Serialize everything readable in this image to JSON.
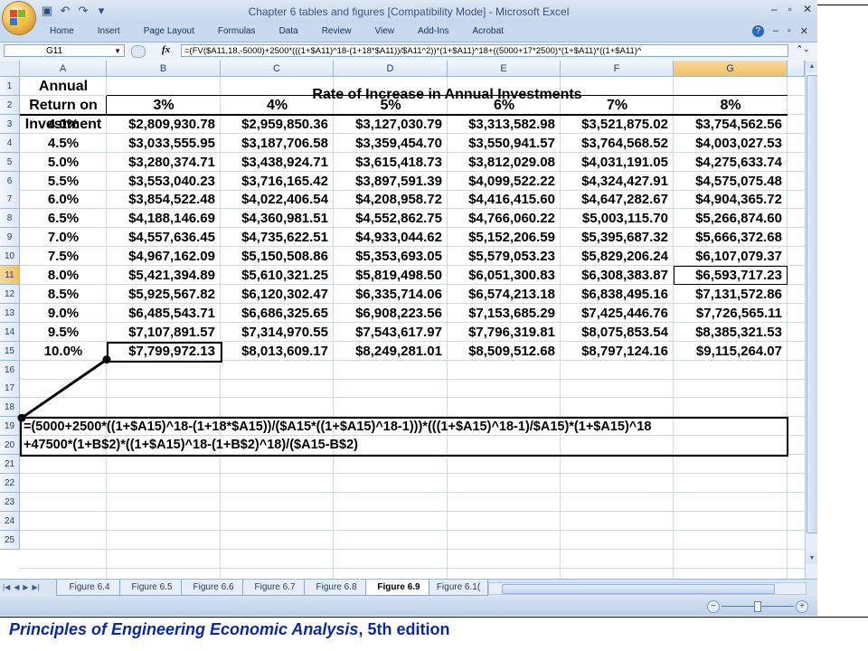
{
  "window": {
    "title": "Chapter 6 tables and figures  [Compatibility Mode] - Microsoft Excel",
    "controls": [
      "–",
      "▫",
      "✕"
    ]
  },
  "quick_access": [
    "save-icon",
    "undo-icon",
    "redo-icon",
    "customize-icon"
  ],
  "menu": {
    "tabs": [
      "Home",
      "Insert",
      "Page Layout",
      "Formulas",
      "Data",
      "Review",
      "View",
      "Add-Ins",
      "Acrobat"
    ]
  },
  "formula_bar": {
    "name_box": "G11",
    "fx": "fx",
    "formula": "=(FV($A11,18,-5000)+2500*(((1+$A11)^18-(1+18*$A11))/$A11^2))*(1+$A11)^18+((5000+17*2500)*(1+$A11)*((1+$A11)^"
  },
  "columns": [
    "A",
    "B",
    "C",
    "D",
    "E",
    "F",
    "G"
  ],
  "rows": [
    "1",
    "2",
    "3",
    "4",
    "5",
    "6",
    "7",
    "8",
    "9",
    "10",
    "11",
    "12",
    "13",
    "14",
    "15",
    "16",
    "17",
    "18",
    "19",
    "20",
    "21",
    "22",
    "23",
    "24",
    "25"
  ],
  "sheet": {
    "a_header": [
      "Annual",
      "Return on",
      "Investment"
    ],
    "title": "Rate of Increase in Annual Investments",
    "rate_headers": [
      "3%",
      "4%",
      "5%",
      "6%",
      "7%",
      "8%"
    ],
    "returns": [
      "4.0%",
      "4.5%",
      "5.0%",
      "5.5%",
      "6.0%",
      "6.5%",
      "7.0%",
      "7.5%",
      "8.0%",
      "8.5%",
      "9.0%",
      "9.5%",
      "10.0%"
    ],
    "values": [
      [
        "$2,809,930.78",
        "$2,959,850.36",
        "$3,127,030.79",
        "$3,313,582.98",
        "$3,521,875.02",
        "$3,754,562.56"
      ],
      [
        "$3,033,555.95",
        "$3,187,706.58",
        "$3,359,454.70",
        "$3,550,941.57",
        "$3,764,568.52",
        "$4,003,027.53"
      ],
      [
        "$3,280,374.71",
        "$3,438,924.71",
        "$3,615,418.73",
        "$3,812,029.08",
        "$4,031,191.05",
        "$4,275,633.74"
      ],
      [
        "$3,553,040.23",
        "$3,716,165.42",
        "$3,897,591.39",
        "$4,099,522.22",
        "$4,324,427.91",
        "$4,575,075.48"
      ],
      [
        "$3,854,522.48",
        "$4,022,406.54",
        "$4,208,958.72",
        "$4,416,415.60",
        "$4,647,282.67",
        "$4,904,365.72"
      ],
      [
        "$4,188,146.69",
        "$4,360,981.51",
        "$4,552,862.75",
        "$4,766,060.22",
        "$5,003,115.70",
        "$5,266,874.60"
      ],
      [
        "$4,557,636.45",
        "$4,735,622.51",
        "$4,933,044.62",
        "$5,152,206.59",
        "$5,395,687.32",
        "$5,666,372.68"
      ],
      [
        "$4,967,162.09",
        "$5,150,508.86",
        "$5,353,693.05",
        "$5,579,053.23",
        "$5,829,206.24",
        "$6,107,079.37"
      ],
      [
        "$5,421,394.89",
        "$5,610,321.25",
        "$5,819,498.50",
        "$6,051,300.83",
        "$6,308,383.87",
        "$6,593,717.23"
      ],
      [
        "$5,925,567.82",
        "$6,120,302.47",
        "$6,335,714.06",
        "$6,574,213.18",
        "$6,838,495.16",
        "$7,131,572.86"
      ],
      [
        "$6,485,543.71",
        "$6,686,325.65",
        "$6,908,223.56",
        "$7,153,685.29",
        "$7,425,446.76",
        "$7,726,565.11"
      ],
      [
        "$7,107,891.57",
        "$7,314,970.55",
        "$7,543,617.97",
        "$7,796,319.81",
        "$8,075,853.54",
        "$8,385,321.53"
      ],
      [
        "$7,799,972.13",
        "$8,013,609.17",
        "$8,249,281.01",
        "$8,509,512.68",
        "$8,797,124.16",
        "$9,115,264.07"
      ]
    ],
    "formula_note_line1": "=(5000+2500*((1+$A15)^18-(1+18*$A15))/($A15*((1+$A15)^18-1)))*(((1+$A15)^18-1)/$A15)*(1+$A15)^18",
    "formula_note_line2": "+47500*(1+B$2)*((1+$A15)^18-(1+B$2)^18)/($A15-B$2)"
  },
  "sheet_tabs": [
    "Figure 6.4",
    "Figure 6.5",
    "Figure 6.6",
    "Figure 6.7",
    "Figure 6.8",
    "Figure 6.9",
    "Figure 6.1("
  ],
  "active_tab": "Figure 6.9",
  "footer": {
    "book": "Principles of Engineering Economic Analysis",
    "edition": ", 5th edition"
  }
}
